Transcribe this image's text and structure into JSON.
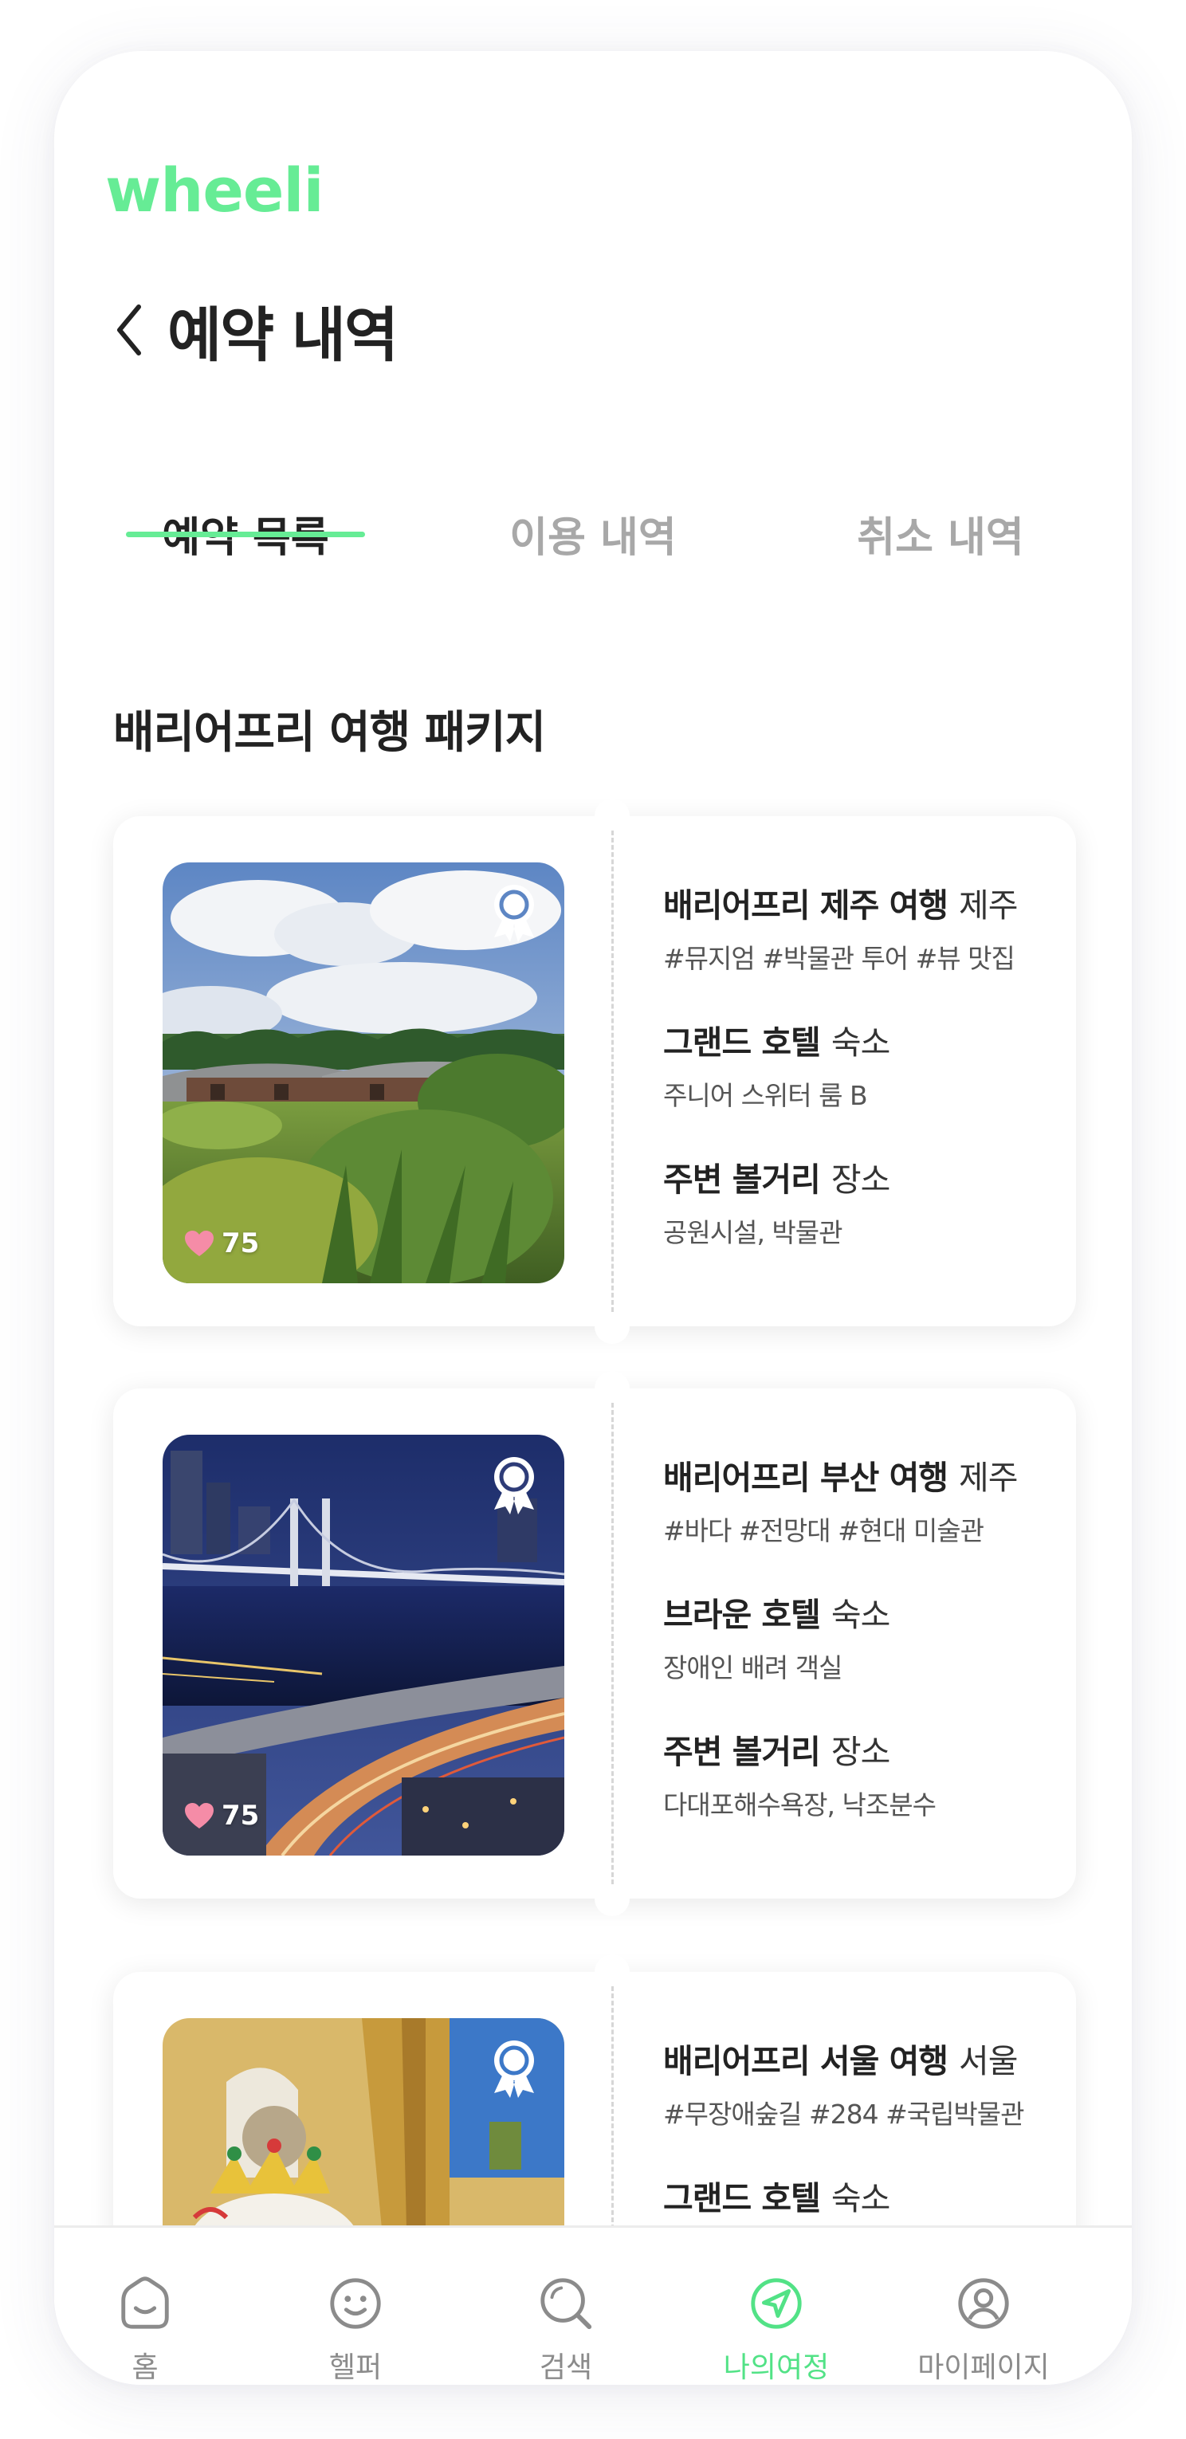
{
  "app": {
    "logo": "wheeli",
    "accent_color": "#66ec95"
  },
  "header": {
    "title": "예약 내역",
    "back_icon": "chevron-left-icon"
  },
  "tabs": [
    {
      "label": "예약 목록",
      "active": true
    },
    {
      "label": "이용 내역",
      "active": false
    },
    {
      "label": "취소 내역",
      "active": false
    }
  ],
  "section": {
    "title": "배리어프리 여행 패키지"
  },
  "packages": [
    {
      "title": "배리어프리 제주 여행",
      "region": "제주",
      "tags": "#뮤지엄 #박물관 투어 #뷰 맛집",
      "hotel_name": "그랜드 호텔",
      "hotel_label": "숙소",
      "room": "주니어 스위터 룸 B",
      "nearby_name": "주변 볼거리",
      "nearby_label": "장소",
      "places": "공원시설, 박물관",
      "likes": "75"
    },
    {
      "title": "배리어프리 부산 여행",
      "region": "제주",
      "tags": "#바다 #전망대 #현대 미술관",
      "hotel_name": "브라운 호텔",
      "hotel_label": "숙소",
      "room": "장애인 배려 객실",
      "nearby_name": "주변 볼거리",
      "nearby_label": "장소",
      "places": "다대포해수욕장, 낙조분수",
      "likes": "75"
    },
    {
      "title": "배리어프리 서울 여행",
      "region": "서울",
      "tags": "#무장애숲길 #284 #국립박물관",
      "hotel_name": "그랜드 호텔",
      "hotel_label": "숙소"
    }
  ],
  "nav": [
    {
      "label": "홈",
      "icon": "home-icon",
      "active": false
    },
    {
      "label": "헬퍼",
      "icon": "smile-icon",
      "active": false
    },
    {
      "label": "검색",
      "icon": "search-icon",
      "active": false
    },
    {
      "label": "나의여정",
      "icon": "navigation-icon",
      "active": true
    },
    {
      "label": "마이페이지",
      "icon": "user-circle-icon",
      "active": false
    }
  ]
}
